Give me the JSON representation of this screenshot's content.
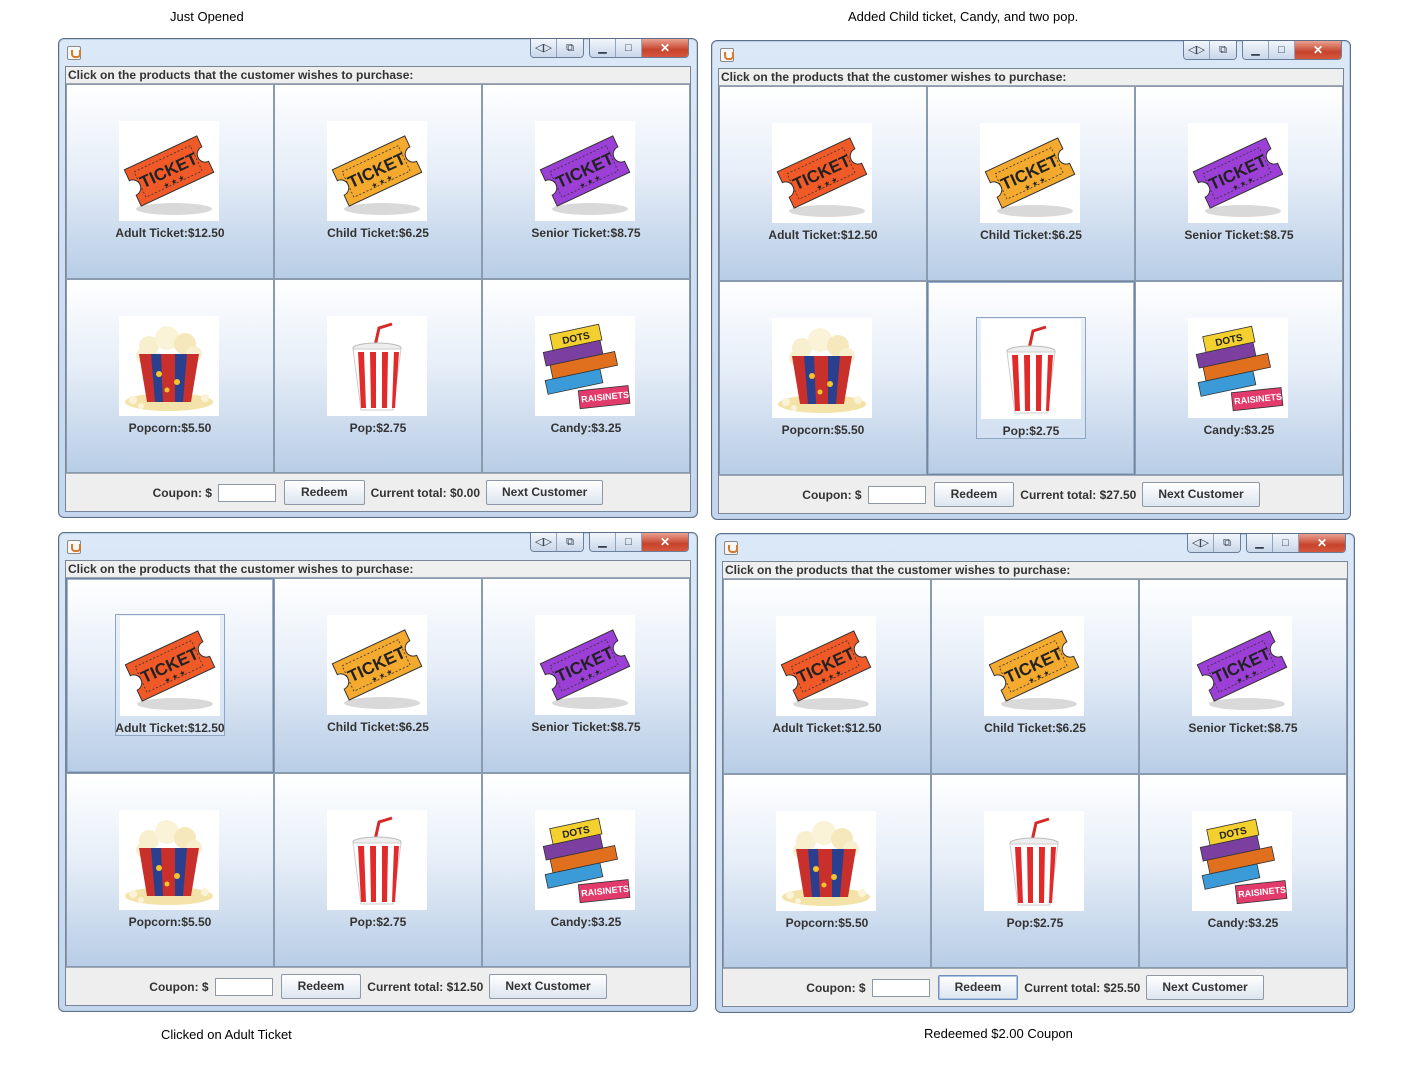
{
  "captions": {
    "top_left": "Just Opened",
    "top_right": "Added Child ticket, Candy, and two pop.",
    "bottom_left": "Clicked on Adult Ticket",
    "bottom_right": "Redeemed $2.00 Coupon"
  },
  "app": {
    "instruction": "Click on the products that the customer wishes to purchase:",
    "coupon_label": "Coupon: $",
    "coupon_value": "",
    "redeem_label": "Redeem",
    "next_label": "Next Customer",
    "products": [
      {
        "label": "Adult Ticket:$12.50",
        "icon": "adult-ticket-icon",
        "color": "#f05a28"
      },
      {
        "label": "Child Ticket:$6.25",
        "icon": "child-ticket-icon",
        "color": "#f4a92f"
      },
      {
        "label": "Senior Ticket:$8.75",
        "icon": "senior-ticket-icon",
        "color": "#9b3fd6"
      },
      {
        "label": "Popcorn:$5.50",
        "icon": "popcorn-icon"
      },
      {
        "label": "Pop:$2.75",
        "icon": "pop-cup-icon"
      },
      {
        "label": "Candy:$3.25",
        "icon": "candy-boxes-icon"
      }
    ]
  },
  "windows": {
    "w1": {
      "total": "Current total: $0.00"
    },
    "w2": {
      "total": "Current total: $27.50"
    },
    "w3": {
      "total": "Current total: $12.50"
    },
    "w4": {
      "total": "Current total: $25.50"
    }
  },
  "title_buttons": [
    "resize-icon",
    "restore-icon",
    "minimize-icon",
    "maximize-icon",
    "close-icon"
  ]
}
